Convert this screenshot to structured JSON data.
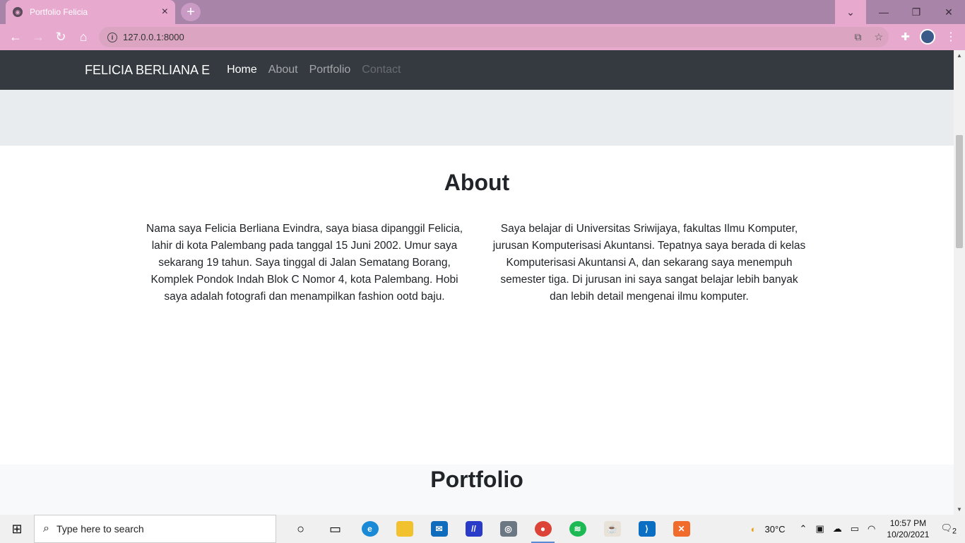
{
  "browser": {
    "tab_title": "Portfolio Felicia",
    "url": "127.0.0.1:8000"
  },
  "navbar": {
    "brand": "FELICIA BERLIANA E",
    "links": [
      "Home",
      "About",
      "Portfolio",
      "Contact"
    ]
  },
  "about": {
    "heading": "About",
    "left": "Nama saya Felicia Berliana Evindra, saya biasa dipanggil Felicia, lahir di kota Palembang pada tanggal 15 Juni 2002. Umur saya sekarang 19 tahun. Saya tinggal di Jalan Sematang Borang, Komplek Pondok Indah Blok C Nomor 4, kota Palembang. Hobi saya adalah fotografi dan menampilkan fashion ootd baju.",
    "right": "Saya belajar di Universitas Sriwijaya, fakultas Ilmu Komputer, jurusan Komputerisasi Akuntansi. Tepatnya saya berada di kelas Komputerisasi Akuntansi A, dan sekarang saya menempuh semester tiga. Di jurusan ini saya sangat belajar lebih banyak dan lebih detail mengenai ilmu komputer."
  },
  "portfolio": {
    "heading": "Portfolio"
  },
  "taskbar": {
    "search_placeholder": "Type here to search",
    "temperature": "30°C",
    "time": "10:57 PM",
    "date": "10/20/2021",
    "notifications": "2"
  },
  "colors": {
    "tabbar": "#a784a8",
    "toolbar": "#e8a9cf",
    "navbar": "#343a40"
  }
}
